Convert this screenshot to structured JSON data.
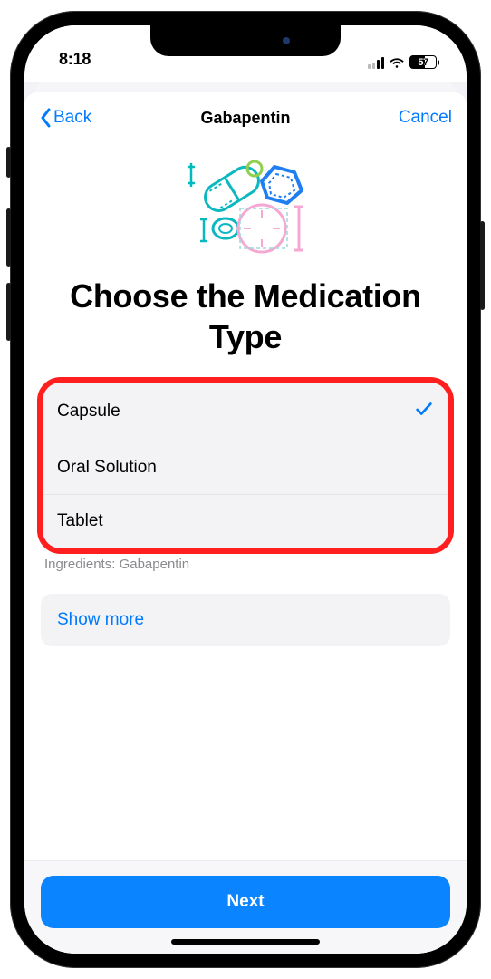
{
  "statusbar": {
    "time": "8:18",
    "battery_percent": "57"
  },
  "navbar": {
    "back_label": "Back",
    "title": "Gabapentin",
    "cancel_label": "Cancel"
  },
  "heading": "Choose the Medication Type",
  "options": [
    {
      "label": "Capsule",
      "selected": true
    },
    {
      "label": "Oral Solution",
      "selected": false
    },
    {
      "label": "Tablet",
      "selected": false
    }
  ],
  "ingredients_label": "Ingredients:",
  "ingredients_value": "Gabapentin",
  "show_more_label": "Show more",
  "next_label": "Next",
  "colors": {
    "accent": "#007aff",
    "primary_button": "#0a84ff",
    "annotation_ring": "#ff1f1f"
  }
}
